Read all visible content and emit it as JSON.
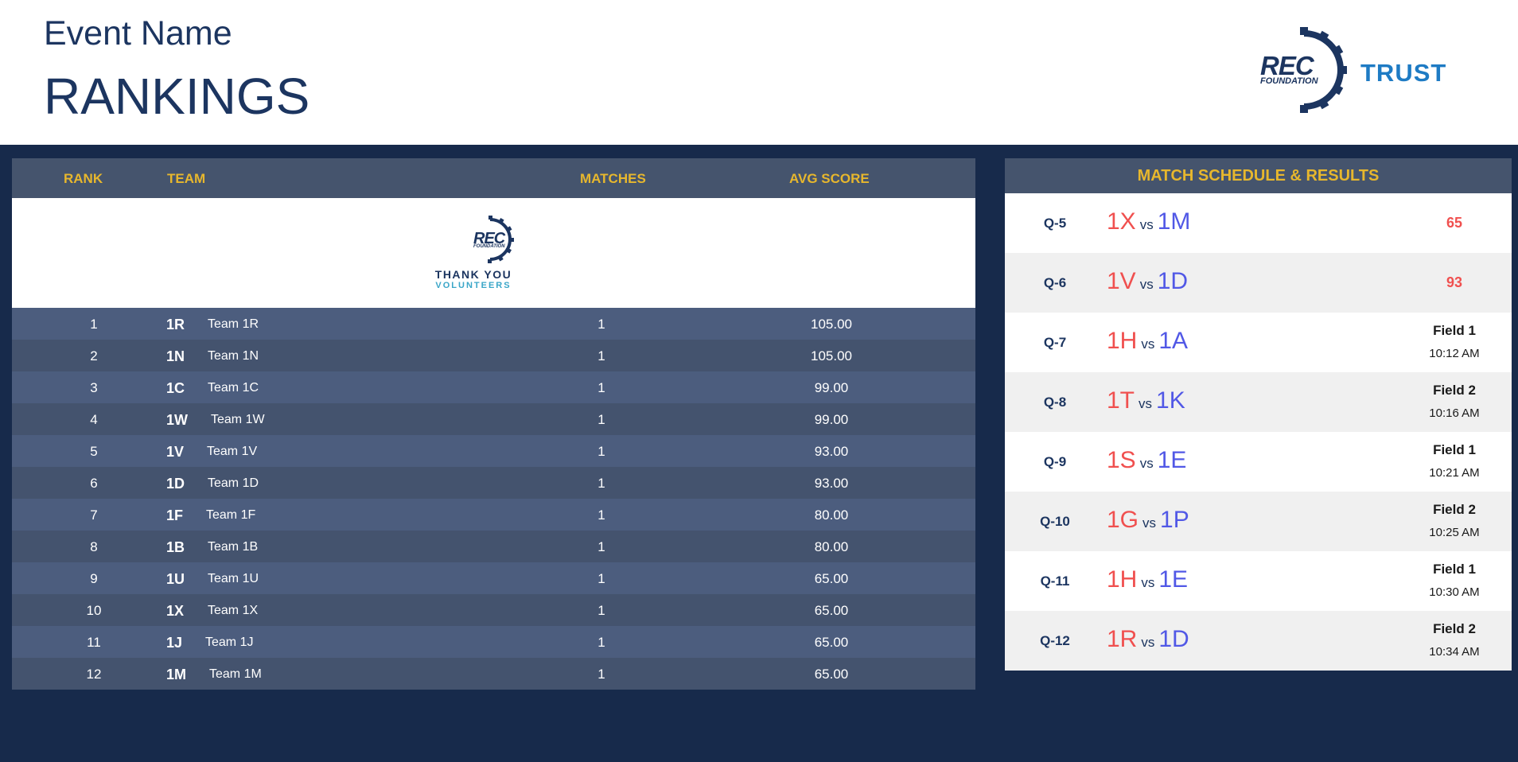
{
  "header": {
    "event_name": "Event Name",
    "title": "RANKINGS",
    "logo_rec": "REC",
    "logo_rec_sub": "FOUNDATION",
    "logo_trust": "TRUST"
  },
  "rankings": {
    "columns": [
      "RANK",
      "TEAM",
      "MATCHES",
      "AVG SCORE"
    ],
    "banner": {
      "logo": "REC",
      "logo_sub": "FOUNDATION",
      "line1": "THANK YOU",
      "line2": "VOLUNTEERS"
    },
    "rows": [
      {
        "rank": "1",
        "num": "1R",
        "name": "Team 1R",
        "matches": "1",
        "avg": "105.00"
      },
      {
        "rank": "2",
        "num": "1N",
        "name": "Team 1N",
        "matches": "1",
        "avg": "105.00"
      },
      {
        "rank": "3",
        "num": "1C",
        "name": "Team 1C",
        "matches": "1",
        "avg": "99.00"
      },
      {
        "rank": "4",
        "num": "1W",
        "name": "Team 1W",
        "matches": "1",
        "avg": "99.00"
      },
      {
        "rank": "5",
        "num": "1V",
        "name": "Team 1V",
        "matches": "1",
        "avg": "93.00"
      },
      {
        "rank": "6",
        "num": "1D",
        "name": "Team 1D",
        "matches": "1",
        "avg": "93.00"
      },
      {
        "rank": "7",
        "num": "1F",
        "name": "Team 1F",
        "matches": "1",
        "avg": "80.00"
      },
      {
        "rank": "8",
        "num": "1B",
        "name": "Team 1B",
        "matches": "1",
        "avg": "80.00"
      },
      {
        "rank": "9",
        "num": "1U",
        "name": "Team 1U",
        "matches": "1",
        "avg": "65.00"
      },
      {
        "rank": "10",
        "num": "1X",
        "name": "Team 1X",
        "matches": "1",
        "avg": "65.00"
      },
      {
        "rank": "11",
        "num": "1J",
        "name": "Team 1J",
        "matches": "1",
        "avg": "65.00"
      },
      {
        "rank": "12",
        "num": "1M",
        "name": "Team 1M",
        "matches": "1",
        "avg": "65.00"
      }
    ]
  },
  "schedule": {
    "title": "MATCH SCHEDULE & RESULTS",
    "vs_label": "vs",
    "matches": [
      {
        "id": "Q-5",
        "red": "1X",
        "blue": "1M",
        "score": "65"
      },
      {
        "id": "Q-6",
        "red": "1V",
        "blue": "1D",
        "score": "93"
      },
      {
        "id": "Q-7",
        "red": "1H",
        "blue": "1A",
        "field": "Field 1",
        "time": "10:12 AM"
      },
      {
        "id": "Q-8",
        "red": "1T",
        "blue": "1K",
        "field": "Field 2",
        "time": "10:16 AM"
      },
      {
        "id": "Q-9",
        "red": "1S",
        "blue": "1E",
        "field": "Field 1",
        "time": "10:21 AM"
      },
      {
        "id": "Q-10",
        "red": "1G",
        "blue": "1P",
        "field": "Field 2",
        "time": "10:25 AM"
      },
      {
        "id": "Q-11",
        "red": "1H",
        "blue": "1E",
        "field": "Field 1",
        "time": "10:30 AM"
      },
      {
        "id": "Q-12",
        "red": "1R",
        "blue": "1D",
        "field": "Field 2",
        "time": "10:34 AM"
      }
    ]
  },
  "colors": {
    "navy": "#172a4b",
    "header_text": "#1c3560",
    "gold": "#e7b72d",
    "red_alliance": "#f0504f",
    "blue_alliance": "#5158e6"
  }
}
